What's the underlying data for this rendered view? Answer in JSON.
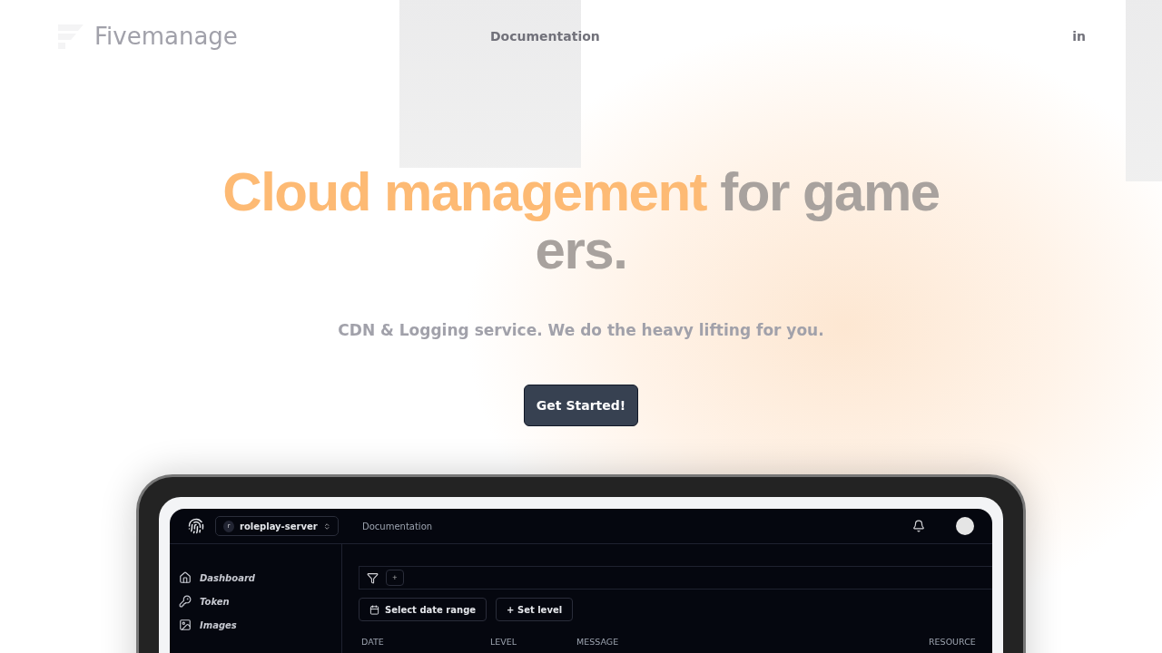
{
  "header": {
    "logo": "Fivemanage",
    "nav": [
      {
        "label": "Documentation"
      }
    ],
    "login": "in"
  },
  "hero": {
    "title_accent": "Cloud management",
    "title_rest": "for game",
    "title_line2": "ers.",
    "subtitle": "CDN & Logging service. We do the heavy lifting for you.",
    "cta": "Get Started!"
  },
  "dashboard": {
    "server": {
      "initial": "r",
      "name": "roleplay-server"
    },
    "top_link": "Documentation",
    "sidebar": [
      {
        "label": "Dashboard",
        "kind": "home"
      },
      {
        "label": "Token",
        "kind": "key"
      },
      {
        "label": "Images",
        "kind": "image"
      }
    ],
    "filter_add": "+",
    "buttons": [
      {
        "label": "Select date range",
        "kind": "date"
      },
      {
        "label": "+ Set level",
        "kind": "plain"
      }
    ],
    "columns": [
      "DATE",
      "LEVEL",
      "MESSAGE",
      "RESOURCE"
    ]
  }
}
